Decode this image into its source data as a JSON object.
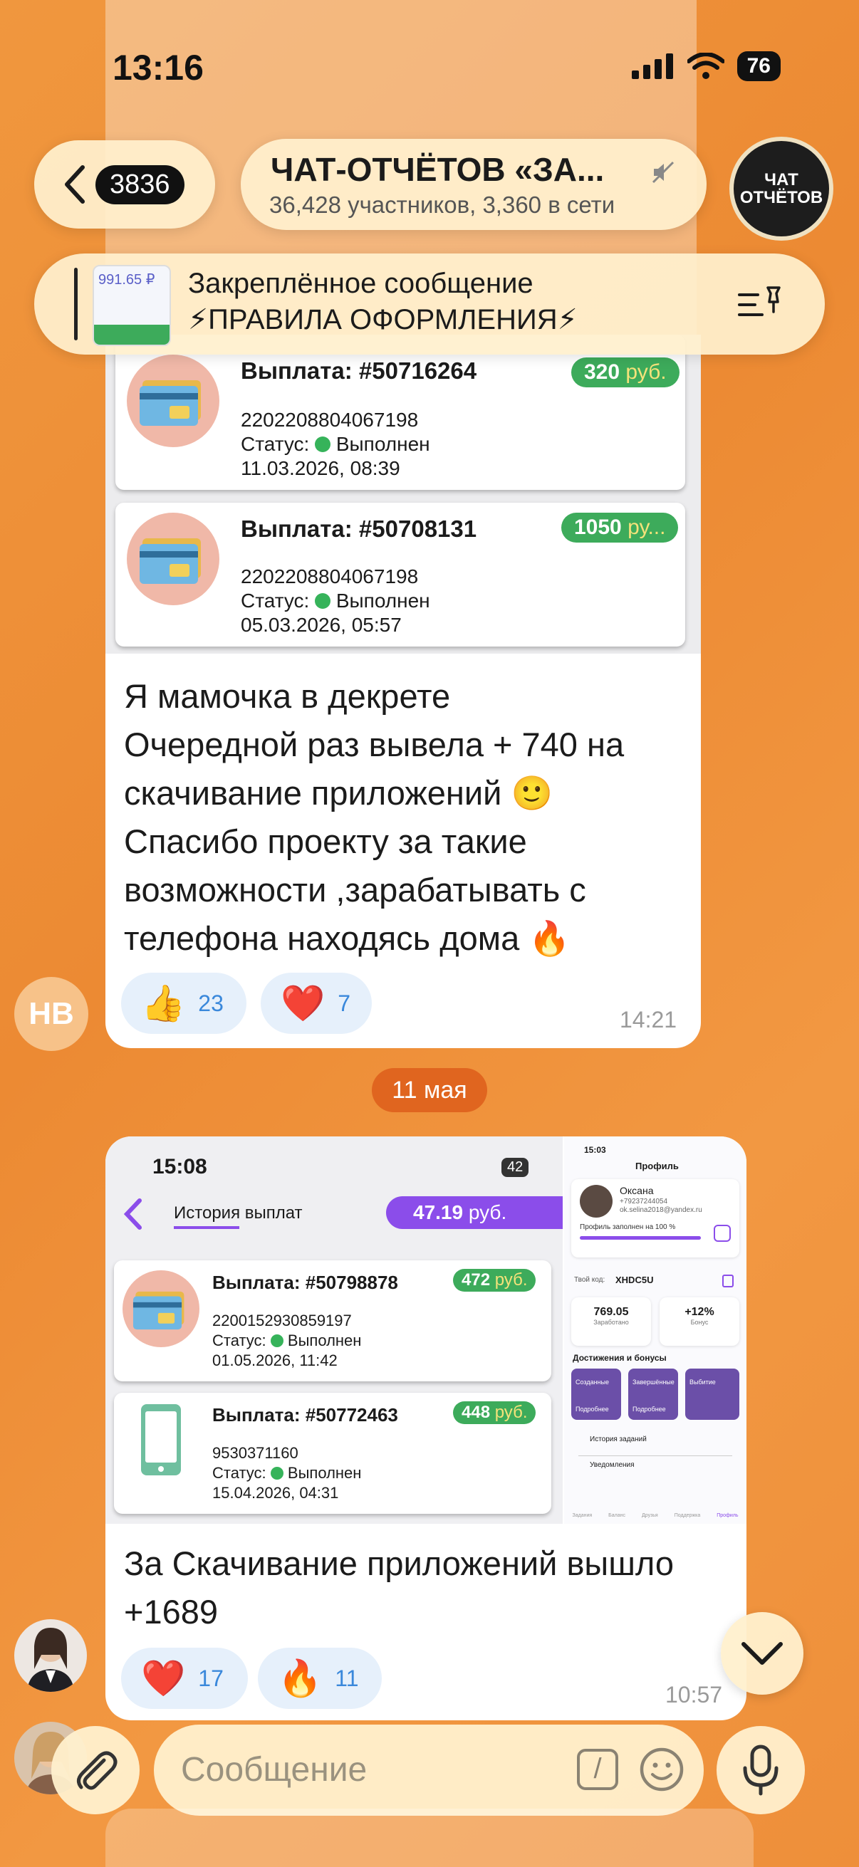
{
  "status_bar": {
    "time": "13:16",
    "battery": "76"
  },
  "header": {
    "back_count": "3836",
    "chat_title": "ЧАТ-ОТЧЁТОВ «ЗА...",
    "chat_subtitle": "36,428 участников, 3,360 в сети",
    "chat_avatar_line1": "ЧАТ",
    "chat_avatar_line2": "ОТЧЁТОВ"
  },
  "pinned": {
    "title": "Закреплённое сообщение",
    "text": "⚡ПРАВИЛА ОФОРМЛЕНИЯ⚡",
    "thumb_amount": "991.65 ₽"
  },
  "message1": {
    "payouts": [
      {
        "title": "Выплата: #50716264",
        "amount": "320",
        "currency": "руб.",
        "account": "2202208804067198",
        "status_label": "Статус:",
        "status": "Выполнен",
        "date": "11.03.2026, 08:39"
      },
      {
        "title": "Выплата: #50708131",
        "amount": "1050",
        "currency": "ру...",
        "account": "2202208804067198",
        "status_label": "Статус:",
        "status": "Выполнен",
        "date": "05.03.2026, 05:57"
      }
    ],
    "text_lines": [
      "Я мамочка в декрете",
      "Очередной раз вывела + 740 на",
      "скачивание приложений 🙂",
      "Спасибо проекту за такие",
      "возможности ,зарабатывать с",
      "телефона находясь дома 🔥"
    ],
    "reactions": [
      {
        "emoji": "👍",
        "count": "23"
      },
      {
        "emoji": "❤️",
        "count": "7"
      }
    ],
    "time": "14:21",
    "sender_initials": "НВ"
  },
  "date_separator": "11 мая",
  "message2": {
    "screenshot_left": {
      "time": "15:08",
      "battery": "42",
      "title": "История выплат",
      "balance": "47.19",
      "balance_currency": "руб.",
      "payouts": [
        {
          "title": "Выплата: #50798878",
          "amount": "472",
          "currency": "руб.",
          "account": "2200152930859197",
          "status_label": "Статус:",
          "status": "Выполнен",
          "date": "01.05.2026, 11:42"
        },
        {
          "title": "Выплата: #50772463",
          "amount": "448",
          "currency": "руб.",
          "account": "9530371160",
          "status_label": "Статус:",
          "status": "Выполнен",
          "date": "15.04.2026, 04:31"
        }
      ]
    },
    "screenshot_right": {
      "time": "15:03",
      "title": "Профиль",
      "name": "Оксана",
      "phone": "+79237244054",
      "email": "ok.selina2018@yandex.ru",
      "profile_filled": "Профиль заполнен на 100 %",
      "code_label": "Твой код:",
      "code": "XHDC5U",
      "earned_value": "769.05",
      "earned_label": "Заработано",
      "bonus_value": "+12%",
      "bonus_label": "Бонус",
      "achievements_title": "Достижения и бонусы",
      "achievements": [
        "Созданные",
        "Завершённые",
        "Выбитие"
      ],
      "achievement_more": "Подробнее",
      "menu": [
        "История заданий",
        "Уведомления"
      ],
      "tabs": [
        "Задания",
        "Баланс",
        "Друзья",
        "Поддержка",
        "Профиль"
      ]
    },
    "text_lines": [
      "За Скачивание приложений вышло",
      "+1689"
    ],
    "reactions": [
      {
        "emoji": "❤️",
        "count": "17"
      },
      {
        "emoji": "🔥",
        "count": "11"
      }
    ],
    "time": "10:57"
  },
  "composer": {
    "placeholder": "Сообщение"
  },
  "colors": {
    "accent_green": "#3dab5b",
    "link_blue": "#3a88db",
    "date_chip": "#e0651f",
    "purple": "#8b4dea"
  },
  "icons": [
    "back-chevron-icon",
    "mute-icon",
    "pin-list-icon",
    "paperclip-icon",
    "command-icon",
    "emoji-icon",
    "microphone-icon",
    "chevron-down-icon",
    "bank-card-icon",
    "phone-icon",
    "check-icon"
  ]
}
